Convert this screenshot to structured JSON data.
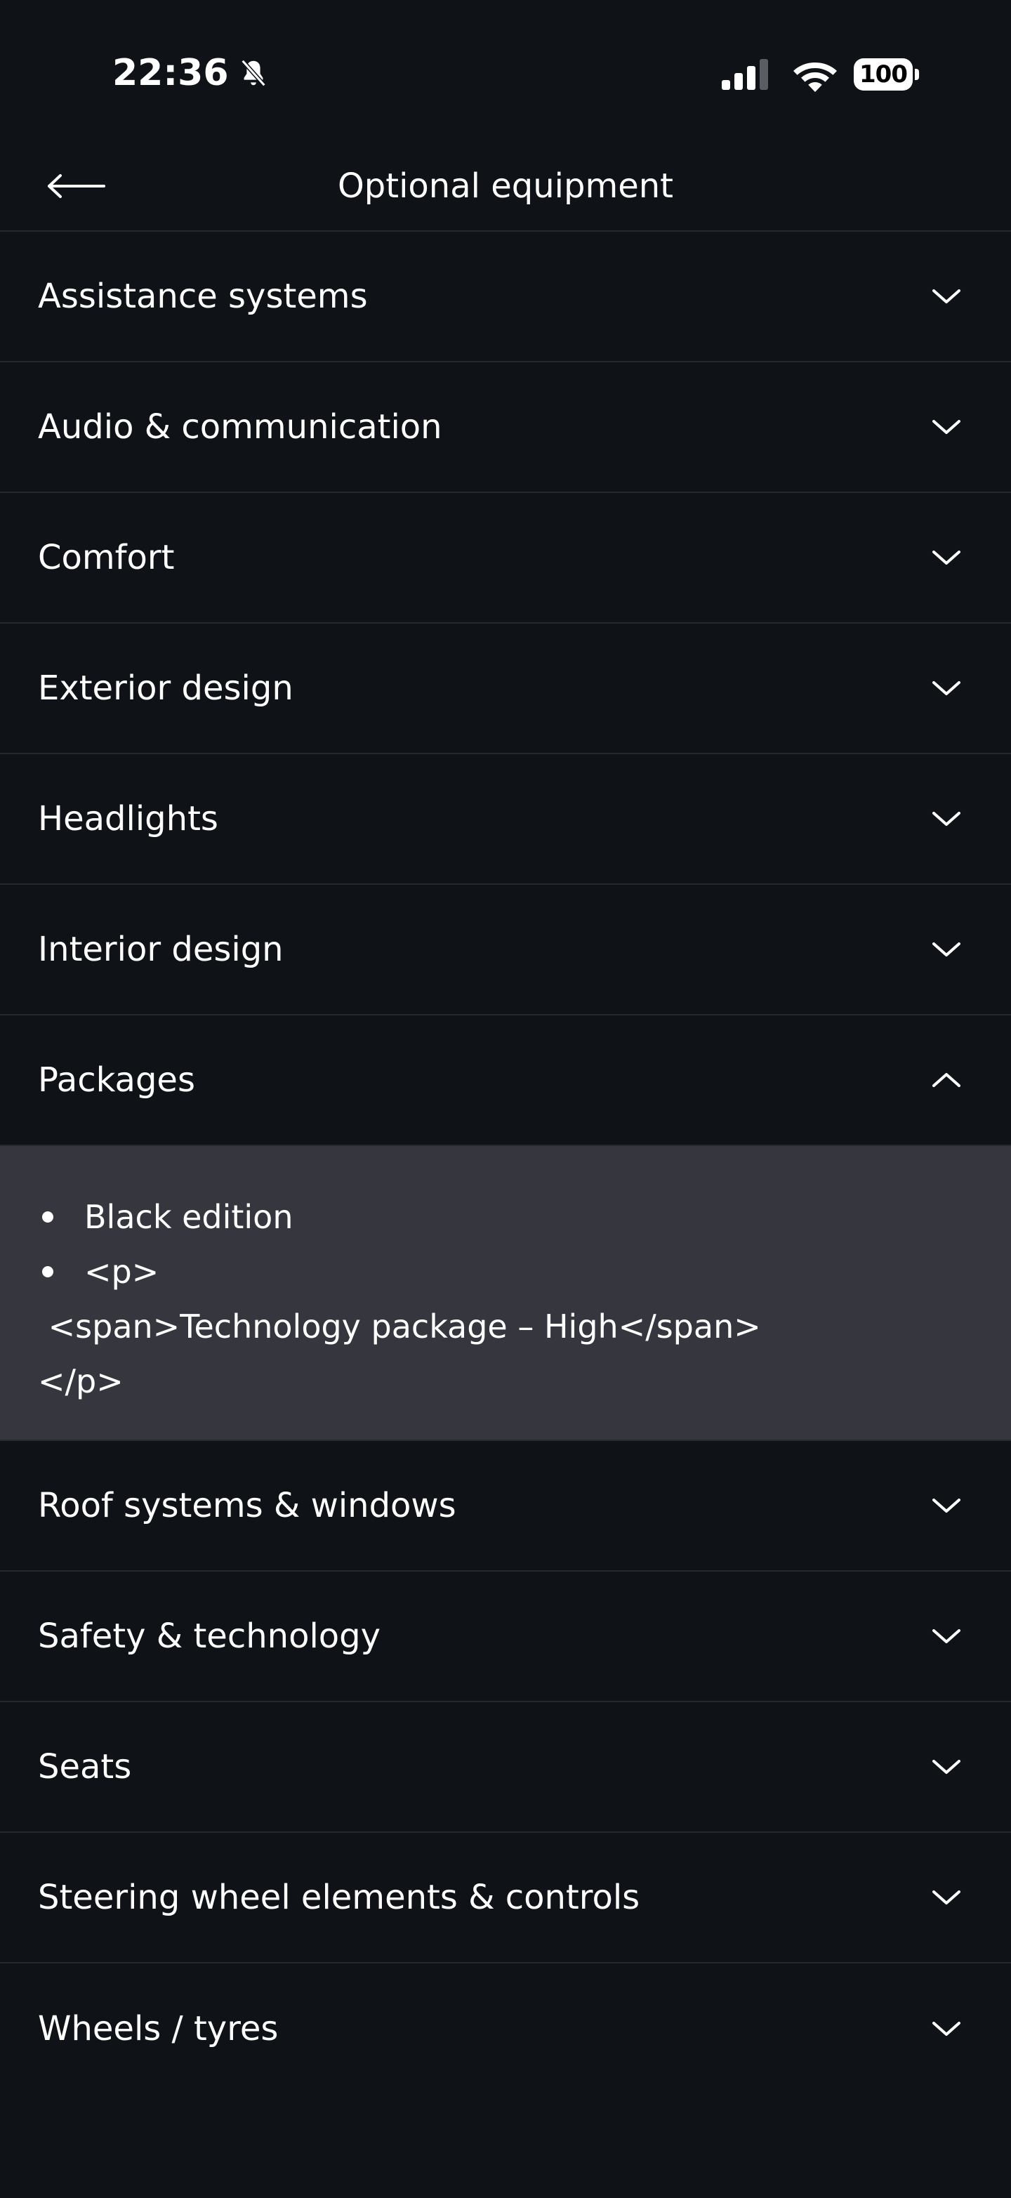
{
  "status_bar": {
    "time": "22:36",
    "battery": "100",
    "icons": [
      "bell-slash-icon",
      "signal-icon",
      "wifi-icon",
      "battery-icon"
    ]
  },
  "header": {
    "title": "Optional equipment",
    "back_icon": "arrow-left-icon"
  },
  "categories": [
    {
      "label": "Assistance systems",
      "expanded": false
    },
    {
      "label": "Audio & communication",
      "expanded": false
    },
    {
      "label": "Comfort",
      "expanded": false
    },
    {
      "label": "Exterior design",
      "expanded": false
    },
    {
      "label": "Headlights",
      "expanded": false
    },
    {
      "label": "Interior design",
      "expanded": false
    },
    {
      "label": "Packages",
      "expanded": true
    },
    {
      "label": "Roof systems & windows",
      "expanded": false
    },
    {
      "label": "Safety & technology",
      "expanded": false
    },
    {
      "label": "Seats",
      "expanded": false
    },
    {
      "label": "Steering wheel elements & controls",
      "expanded": false
    },
    {
      "label": "Wheels / tyres",
      "expanded": false
    }
  ],
  "packages_panel": {
    "items": [
      "Black edition",
      "<p>"
    ],
    "raw_lines": [
      " <span>Technology package – High</span>",
      "</p>"
    ]
  },
  "colors": {
    "background": "#0f1318",
    "divider": "#262b31",
    "expanded_panel": "#36373e",
    "text": "#ffffff"
  }
}
